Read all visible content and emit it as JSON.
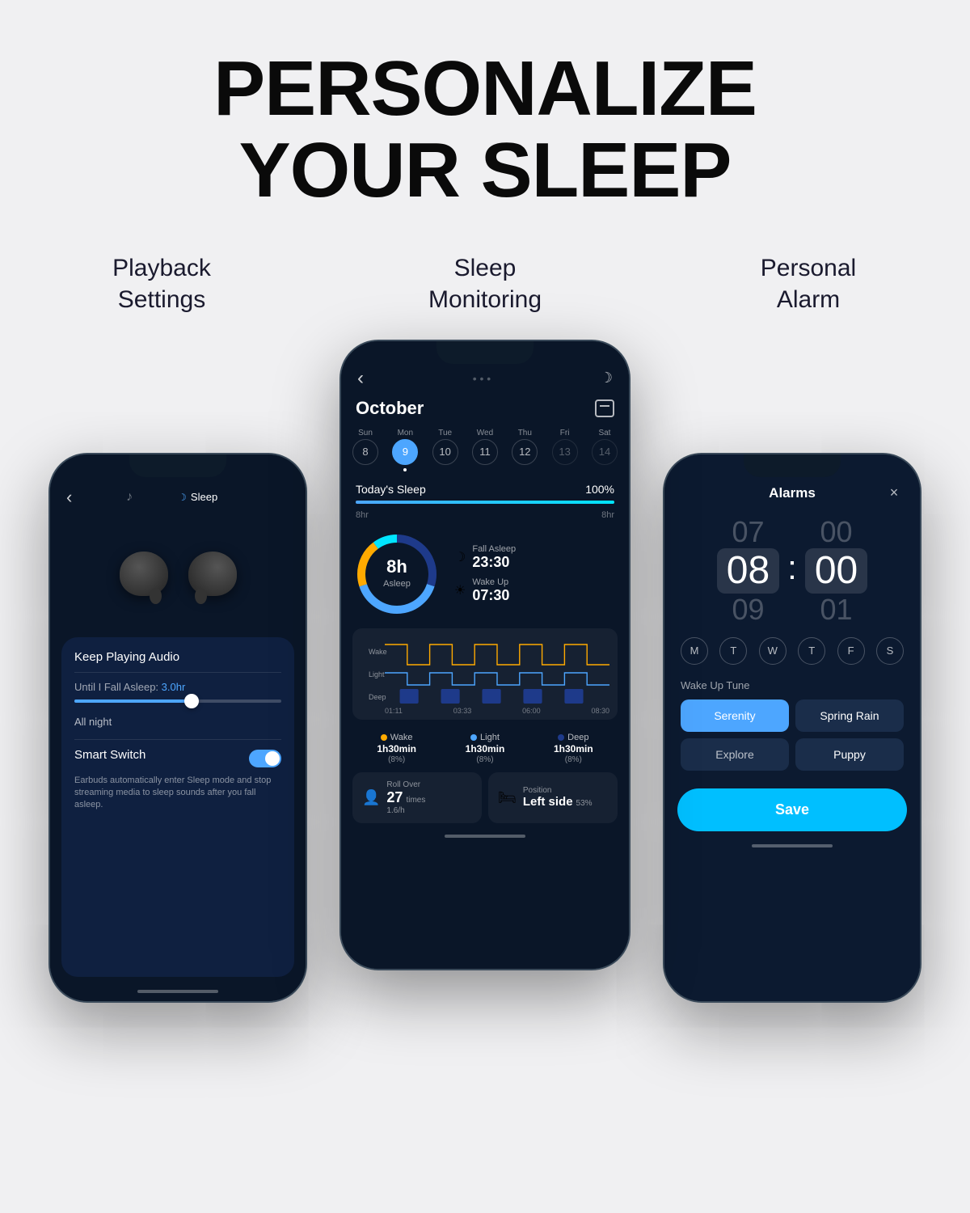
{
  "page": {
    "title_line1": "PERSONALIZE",
    "title_line2": "YOUR SLEEP",
    "background_color": "#f0f0f2"
  },
  "subtitles": {
    "left": "Playback\nSettings",
    "center": "Sleep\nMonitoring",
    "right": "Personal\nAlarm"
  },
  "left_phone": {
    "tab_music": "♪",
    "tab_sleep": "Sleep",
    "keep_playing_label": "Keep Playing Audio",
    "until_label": "Until I Fall Asleep:",
    "until_value": "3.0hr",
    "all_night": "All night",
    "smart_switch_title": "Smart Switch",
    "smart_switch_desc": "Earbuds automatically enter Sleep mode and stop streaming media to sleep sounds after you fall asleep."
  },
  "center_phone": {
    "back_arrow": "‹",
    "month": "October",
    "days": [
      "Sun",
      "Mon",
      "Tue",
      "Wed",
      "Thu",
      "Fri",
      "Sat"
    ],
    "dates": [
      "8",
      "9",
      "10",
      "11",
      "12",
      "13",
      "14"
    ],
    "active_day_index": 1,
    "today_sleep_label": "Today's Sleep",
    "today_sleep_pct": "100%",
    "bar_min": "8hr",
    "bar_max": "8hr",
    "donut_hours": "8h",
    "donut_sublabel": "Asleep",
    "fall_asleep_label": "Fall Asleep",
    "fall_asleep_time": "23:30",
    "wake_up_label": "Wake Up",
    "wake_up_time": "07:30",
    "graph_stages": [
      "Wake",
      "Light",
      "Deep"
    ],
    "graph_times": [
      "01:11",
      "03:33",
      "06:00",
      "08:30"
    ],
    "legend": [
      {
        "dot_color": "#ffaa00",
        "label": "Wake",
        "duration": "1h30min",
        "pct": "(8%)"
      },
      {
        "dot_color": "#4da6ff",
        "label": "Light",
        "duration": "1h30min",
        "pct": "(8%)"
      },
      {
        "dot_color": "#1e3a8a",
        "label": "Deep",
        "duration": "1h30min",
        "pct": "(8%)"
      }
    ],
    "roll_over_label": "Roll Over",
    "roll_over_value": "27",
    "roll_over_unit": "times",
    "roll_over_rate": "1.6/h",
    "position_label": "Position",
    "position_value": "Left side",
    "position_pct": "53%"
  },
  "right_phone": {
    "alarms_title": "Alarms",
    "close_icon": "×",
    "time_above": "07",
    "time_hour": "08",
    "time_below": "09",
    "time_min_above": "00",
    "time_min": "00",
    "time_min_below": "01",
    "days": [
      "M",
      "T",
      "W",
      "T",
      "F",
      "S"
    ],
    "wake_up_tune_label": "Up Tune",
    "tunes": [
      {
        "label": "Serenity",
        "active": true
      },
      {
        "label": "Spring Rain",
        "active": false
      },
      {
        "label": "Explore",
        "active": false
      },
      {
        "label": "Puppy",
        "active": false
      }
    ],
    "save_label": "Save"
  }
}
